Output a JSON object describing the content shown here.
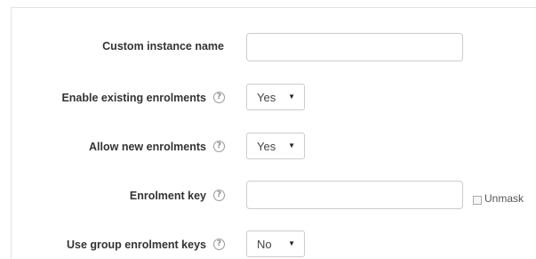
{
  "form": {
    "custom_instance_name": {
      "label": "Custom instance name",
      "value": "",
      "placeholder": ""
    },
    "enable_existing_enrolments": {
      "label": "Enable existing enrolments",
      "value": "Yes"
    },
    "allow_new_enrolments": {
      "label": "Allow new enrolments",
      "value": "Yes"
    },
    "enrolment_key": {
      "label": "Enrolment key",
      "value": "",
      "unmask_label": "Unmask",
      "unmask_checked": false
    },
    "use_group_enrolment_keys": {
      "label": "Use group enrolment keys",
      "value": "No"
    },
    "help_glyph": "?",
    "caret_glyph": "▼"
  },
  "icons": {
    "help": "help-icon",
    "dropdown": "chevron-down-icon"
  }
}
